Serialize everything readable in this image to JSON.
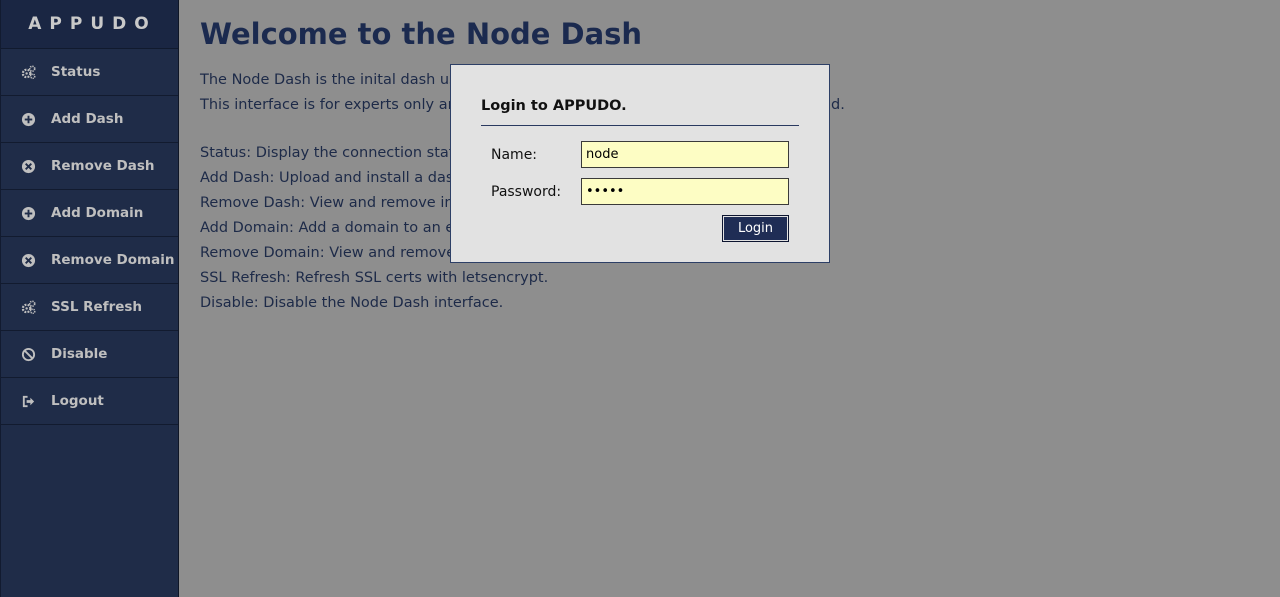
{
  "sidebar": {
    "brand": "APPUDO",
    "items": [
      {
        "label": "Status",
        "icon": "gears-icon"
      },
      {
        "label": "Add Dash",
        "icon": "plus-circle-icon"
      },
      {
        "label": "Remove Dash",
        "icon": "x-circle-icon"
      },
      {
        "label": "Add Domain",
        "icon": "plus-circle-icon"
      },
      {
        "label": "Remove Domain",
        "icon": "x-circle-icon"
      },
      {
        "label": "SSL Refresh",
        "icon": "gears-icon"
      },
      {
        "label": "Disable",
        "icon": "ban-icon"
      },
      {
        "label": "Logout",
        "icon": "sign-out-icon"
      }
    ]
  },
  "main": {
    "title": "Welcome to the Node Dash",
    "intro": [
      "The Node Dash is the inital dash use",
      "This interface is for experts only and"
    ],
    "intro_tail": "d.",
    "features": [
      "Status: Display the connection status",
      "Add Dash: Upload and install a dash",
      "Remove Dash: View and remove ins",
      "Add Domain: Add a domain to an ex",
      "Remove Domain: View and remove",
      "SSL Refresh: Refresh SSL certs with letsencrypt.",
      "Disable: Disable the Node Dash interface."
    ]
  },
  "login": {
    "title": "Login to APPUDO.",
    "name_label": "Name:",
    "name_value": "node",
    "password_label": "Password:",
    "password_value": "•••••",
    "button": "Login"
  },
  "colors": {
    "sidebar_bg": "#1f2c48",
    "overlay_bg": "#8e8e8e",
    "heading": "#1b2a4f",
    "modal_bg": "#e2e2e2",
    "input_bg": "#fdfdc4",
    "button_bg": "#1f2d55"
  }
}
